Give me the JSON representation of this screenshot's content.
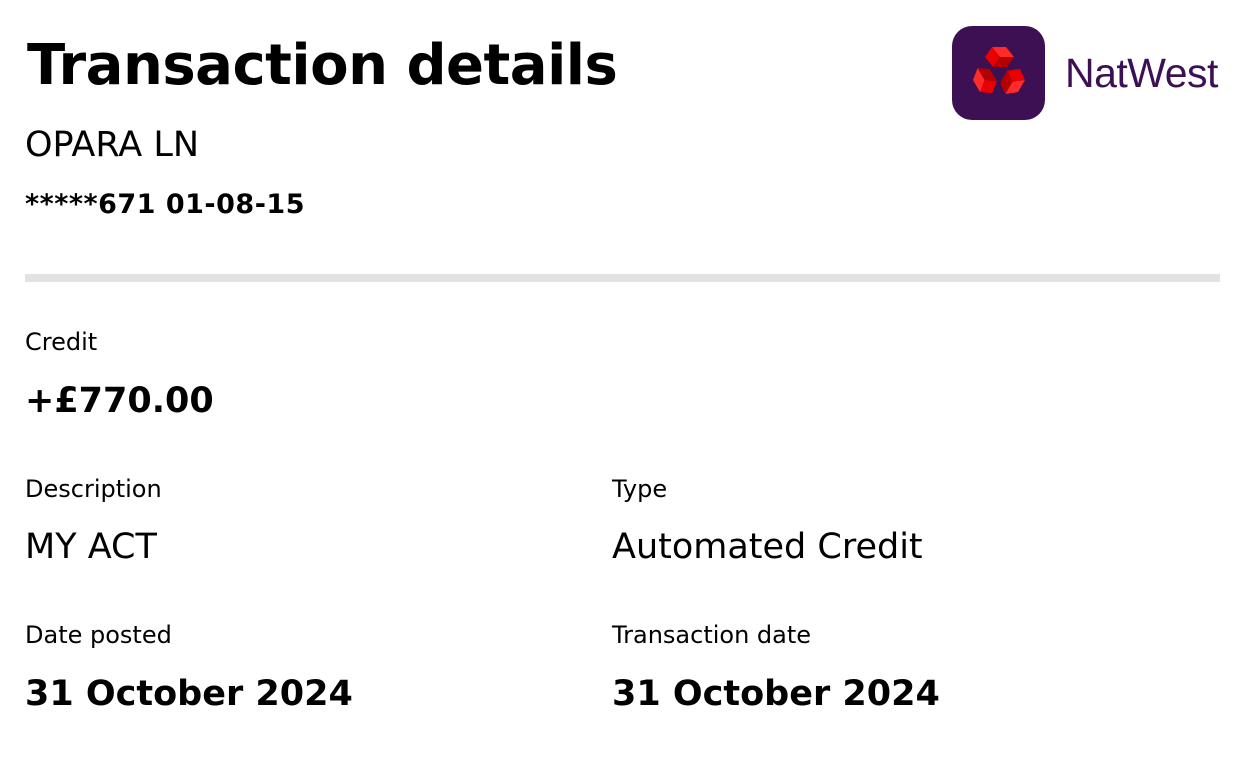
{
  "header": {
    "title": "Transaction details",
    "account_name": "OPARA LN",
    "account_number": "*****671 01-08-15"
  },
  "brand": {
    "name": "NatWest",
    "logo_icon": "natwest-cubes-icon",
    "colors": {
      "purple": "#3c1053",
      "red": "#e90000"
    }
  },
  "details": {
    "credit": {
      "label": "Credit",
      "value": "+£770.00"
    },
    "description": {
      "label": "Description",
      "value": "MY ACT"
    },
    "type": {
      "label": "Type",
      "value": "Automated Credit"
    },
    "date_posted": {
      "label": "Date posted",
      "value": "31 October 2024"
    },
    "transaction_date": {
      "label": "Transaction date",
      "value": "31 October 2024"
    }
  }
}
